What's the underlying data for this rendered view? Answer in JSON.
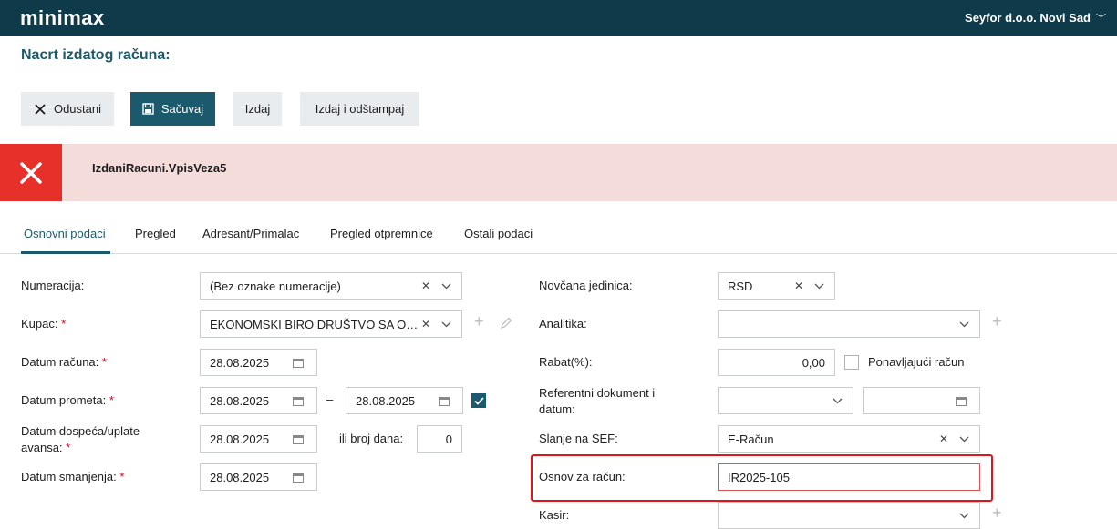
{
  "header": {
    "logo": "minimax",
    "organization": "Seyfor d.o.o. Novi Sad",
    "org_chevron": "﹀"
  },
  "page": {
    "title": "Nacrt izdatog računa:"
  },
  "toolbar": {
    "cancel_label": "Odustani",
    "save_label": "Sačuvaj",
    "issue_label": "Izdaj",
    "issue_print_label": "Izdaj i odštampaj"
  },
  "alert": {
    "message": "IzdaniRacuni.VpisVeza5",
    "icon": "close-x-icon",
    "color": "#e8302a"
  },
  "tabs": [
    {
      "label": "Osnovni podaci",
      "active": true
    },
    {
      "label": "Pregled"
    },
    {
      "label": "Adresant/Primalac"
    },
    {
      "label": "Pregled otpremnice"
    },
    {
      "label": "Ostali podaci"
    }
  ],
  "form_left": {
    "numeracija": {
      "label": "Numeracija:",
      "value": "(Bez oznake numeracije)"
    },
    "kupac": {
      "label": "Kupac:",
      "value": "EKONOMSKI BIRO DRUŠTVO SA OGRANIČENOM ODGOVORNOŠĆU"
    },
    "datum_racuna": {
      "label": "Datum računa:",
      "value": "28.08.2025"
    },
    "datum_prometa": {
      "label": "Datum prometa:",
      "from": "28.08.2025",
      "separator": "–",
      "to": "28.08.2025",
      "checked": true
    },
    "datum_dospeca": {
      "label_line1": "Datum dospeća/uplate",
      "label_line2": "avansa:",
      "value": "28.08.2025",
      "days_label": "ili broj dana:",
      "days": "0"
    },
    "datum_smanjenja": {
      "label": "Datum smanjenja:",
      "value": "28.08.2025"
    },
    "required_mark": "*"
  },
  "form_right": {
    "novcana_jedinica": {
      "label": "Novčana jedinica:",
      "value": "RSD"
    },
    "analitika": {
      "label": "Analitika:",
      "value": ""
    },
    "rabat": {
      "label": "Rabat(%):",
      "value": "0,00",
      "checkbox_label": "Ponavljajući račun",
      "checked": false
    },
    "referentni": {
      "label_line1": "Referentni dokument i",
      "label_line2": "datum:",
      "value": "",
      "date": ""
    },
    "slanje_sef": {
      "label": "Slanje na SEF:",
      "value": "E-Račun"
    },
    "osnov": {
      "label": "Osnov za račun:",
      "value": "IR2025-105"
    },
    "kasir": {
      "label": "Kasir:",
      "value": ""
    }
  },
  "glyphs": {
    "clear": "✕",
    "plus": "+"
  },
  "colors": {
    "topbar": "#0e3a4a",
    "primary": "#1b5a6c",
    "alert_bg": "#f4dcda",
    "highlight": "#e2141b"
  }
}
